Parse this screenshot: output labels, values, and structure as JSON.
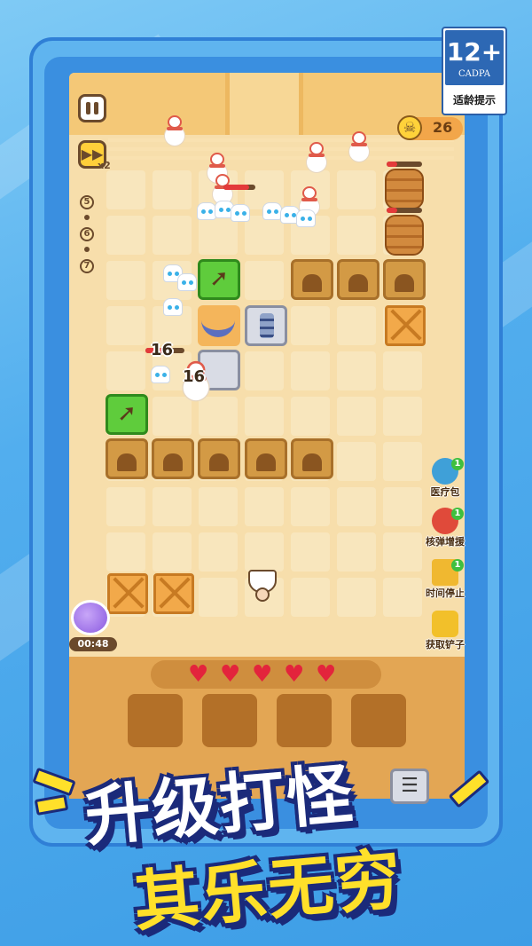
{
  "age_rating": {
    "number": "12+",
    "org": "CADPA",
    "tip": "适龄提示"
  },
  "hud": {
    "speed_multiplier": "x2",
    "skull_count": "26",
    "waves": [
      "5",
      "6",
      "7"
    ],
    "timer": "00:48"
  },
  "damage_numbers": [
    "16",
    "16"
  ],
  "items": [
    {
      "name": "medkit",
      "label": "医疗包",
      "count": "1",
      "color": "#3fa0d8"
    },
    {
      "name": "nuke",
      "label": "核弹增援",
      "count": "1",
      "color": "#e04a3a"
    },
    {
      "name": "time-stop",
      "label": "时间停止",
      "count": "1",
      "color": "#f0b830"
    },
    {
      "name": "shovel",
      "label": "获取铲子",
      "count": "",
      "color": "#f2c02a"
    }
  ],
  "hearts": 5,
  "banner": {
    "line1": "升级打怪",
    "line2": "其乐无穷"
  }
}
